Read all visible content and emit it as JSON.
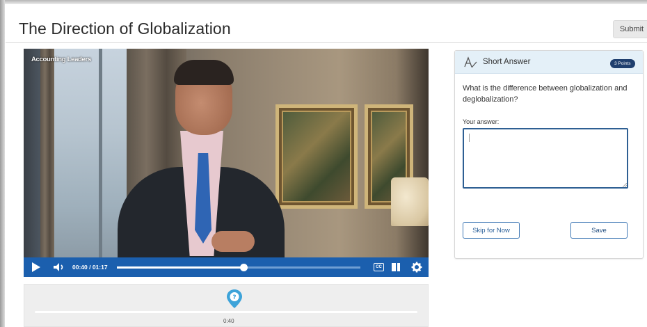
{
  "header": {
    "title": "The Direction of Globalization",
    "submit_label": "Submit"
  },
  "video": {
    "overlay_label": "Accounting Leaders",
    "controls": {
      "time_display": "00:40 / 01:17",
      "progress_fraction": 0.52,
      "captions_label": "CC",
      "icons": [
        "play-icon",
        "volume-icon",
        "captions-icon",
        "transcript-pane-icon",
        "settings-gear-icon"
      ]
    }
  },
  "timeline": {
    "marker_icon": "question-marker-icon",
    "marker_time": "0:40"
  },
  "question_card": {
    "type_icon": "short-answer-icon",
    "type_label": "Short Answer",
    "points_badge": "3 Points",
    "question_text": "What is the difference between globalization and deglobalization?",
    "answer_label": "Your answer:",
    "answer_value": "",
    "skip_label": "Skip for Now",
    "save_label": "Save"
  },
  "colors": {
    "accent_blue": "#1b5fae",
    "card_header_bg": "#e4f0f8",
    "badge_bg": "#1f3f6e",
    "button_border": "#3e77b4"
  }
}
